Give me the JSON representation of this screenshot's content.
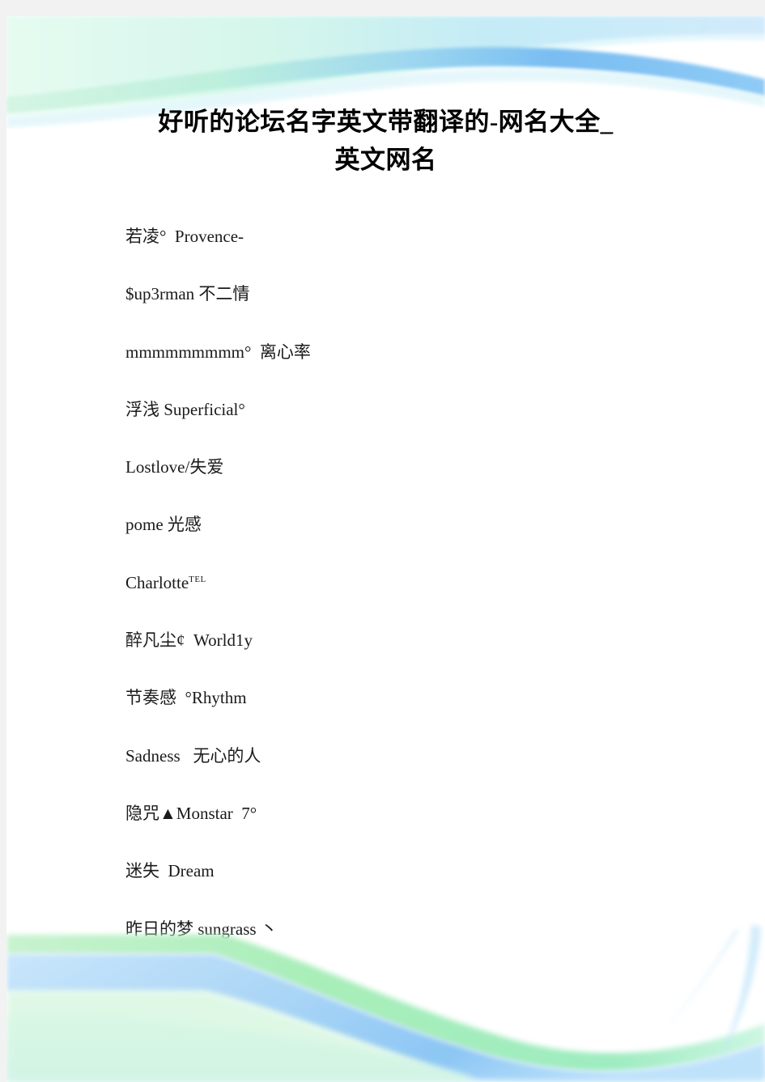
{
  "document": {
    "title_lines": [
      "好听的论坛名字英文带翻译的-网名大全_",
      "英文网名"
    ],
    "paragraphs": [
      "若凌°  Provence-",
      "$up3rman 不二情",
      "mmmmmmmmm°  离心率",
      "浮浅 Superficial°",
      "Lostlove/失爱",
      "pome 光感",
      "Charlotte",
      "醉凡尘¢  World1y",
      "节奏感  °Rhythm",
      "Sadness   无心的人",
      "隐咒▲Monstar  7°",
      "迷失  Dream",
      "昨日的梦 sungrass 丶"
    ],
    "charlotte_superscript": "TEL"
  },
  "colors": {
    "page_background": "#ffffff",
    "canvas_background": "#f2f2f2",
    "text": "#1a1a1a",
    "title": "#000000",
    "art_green": "#8ce69b",
    "art_green_light": "#d9f7e2",
    "art_blue": "#7fbdf0",
    "art_blue_light": "#c7e6fa",
    "art_cyan_light": "#ddf6fb"
  }
}
